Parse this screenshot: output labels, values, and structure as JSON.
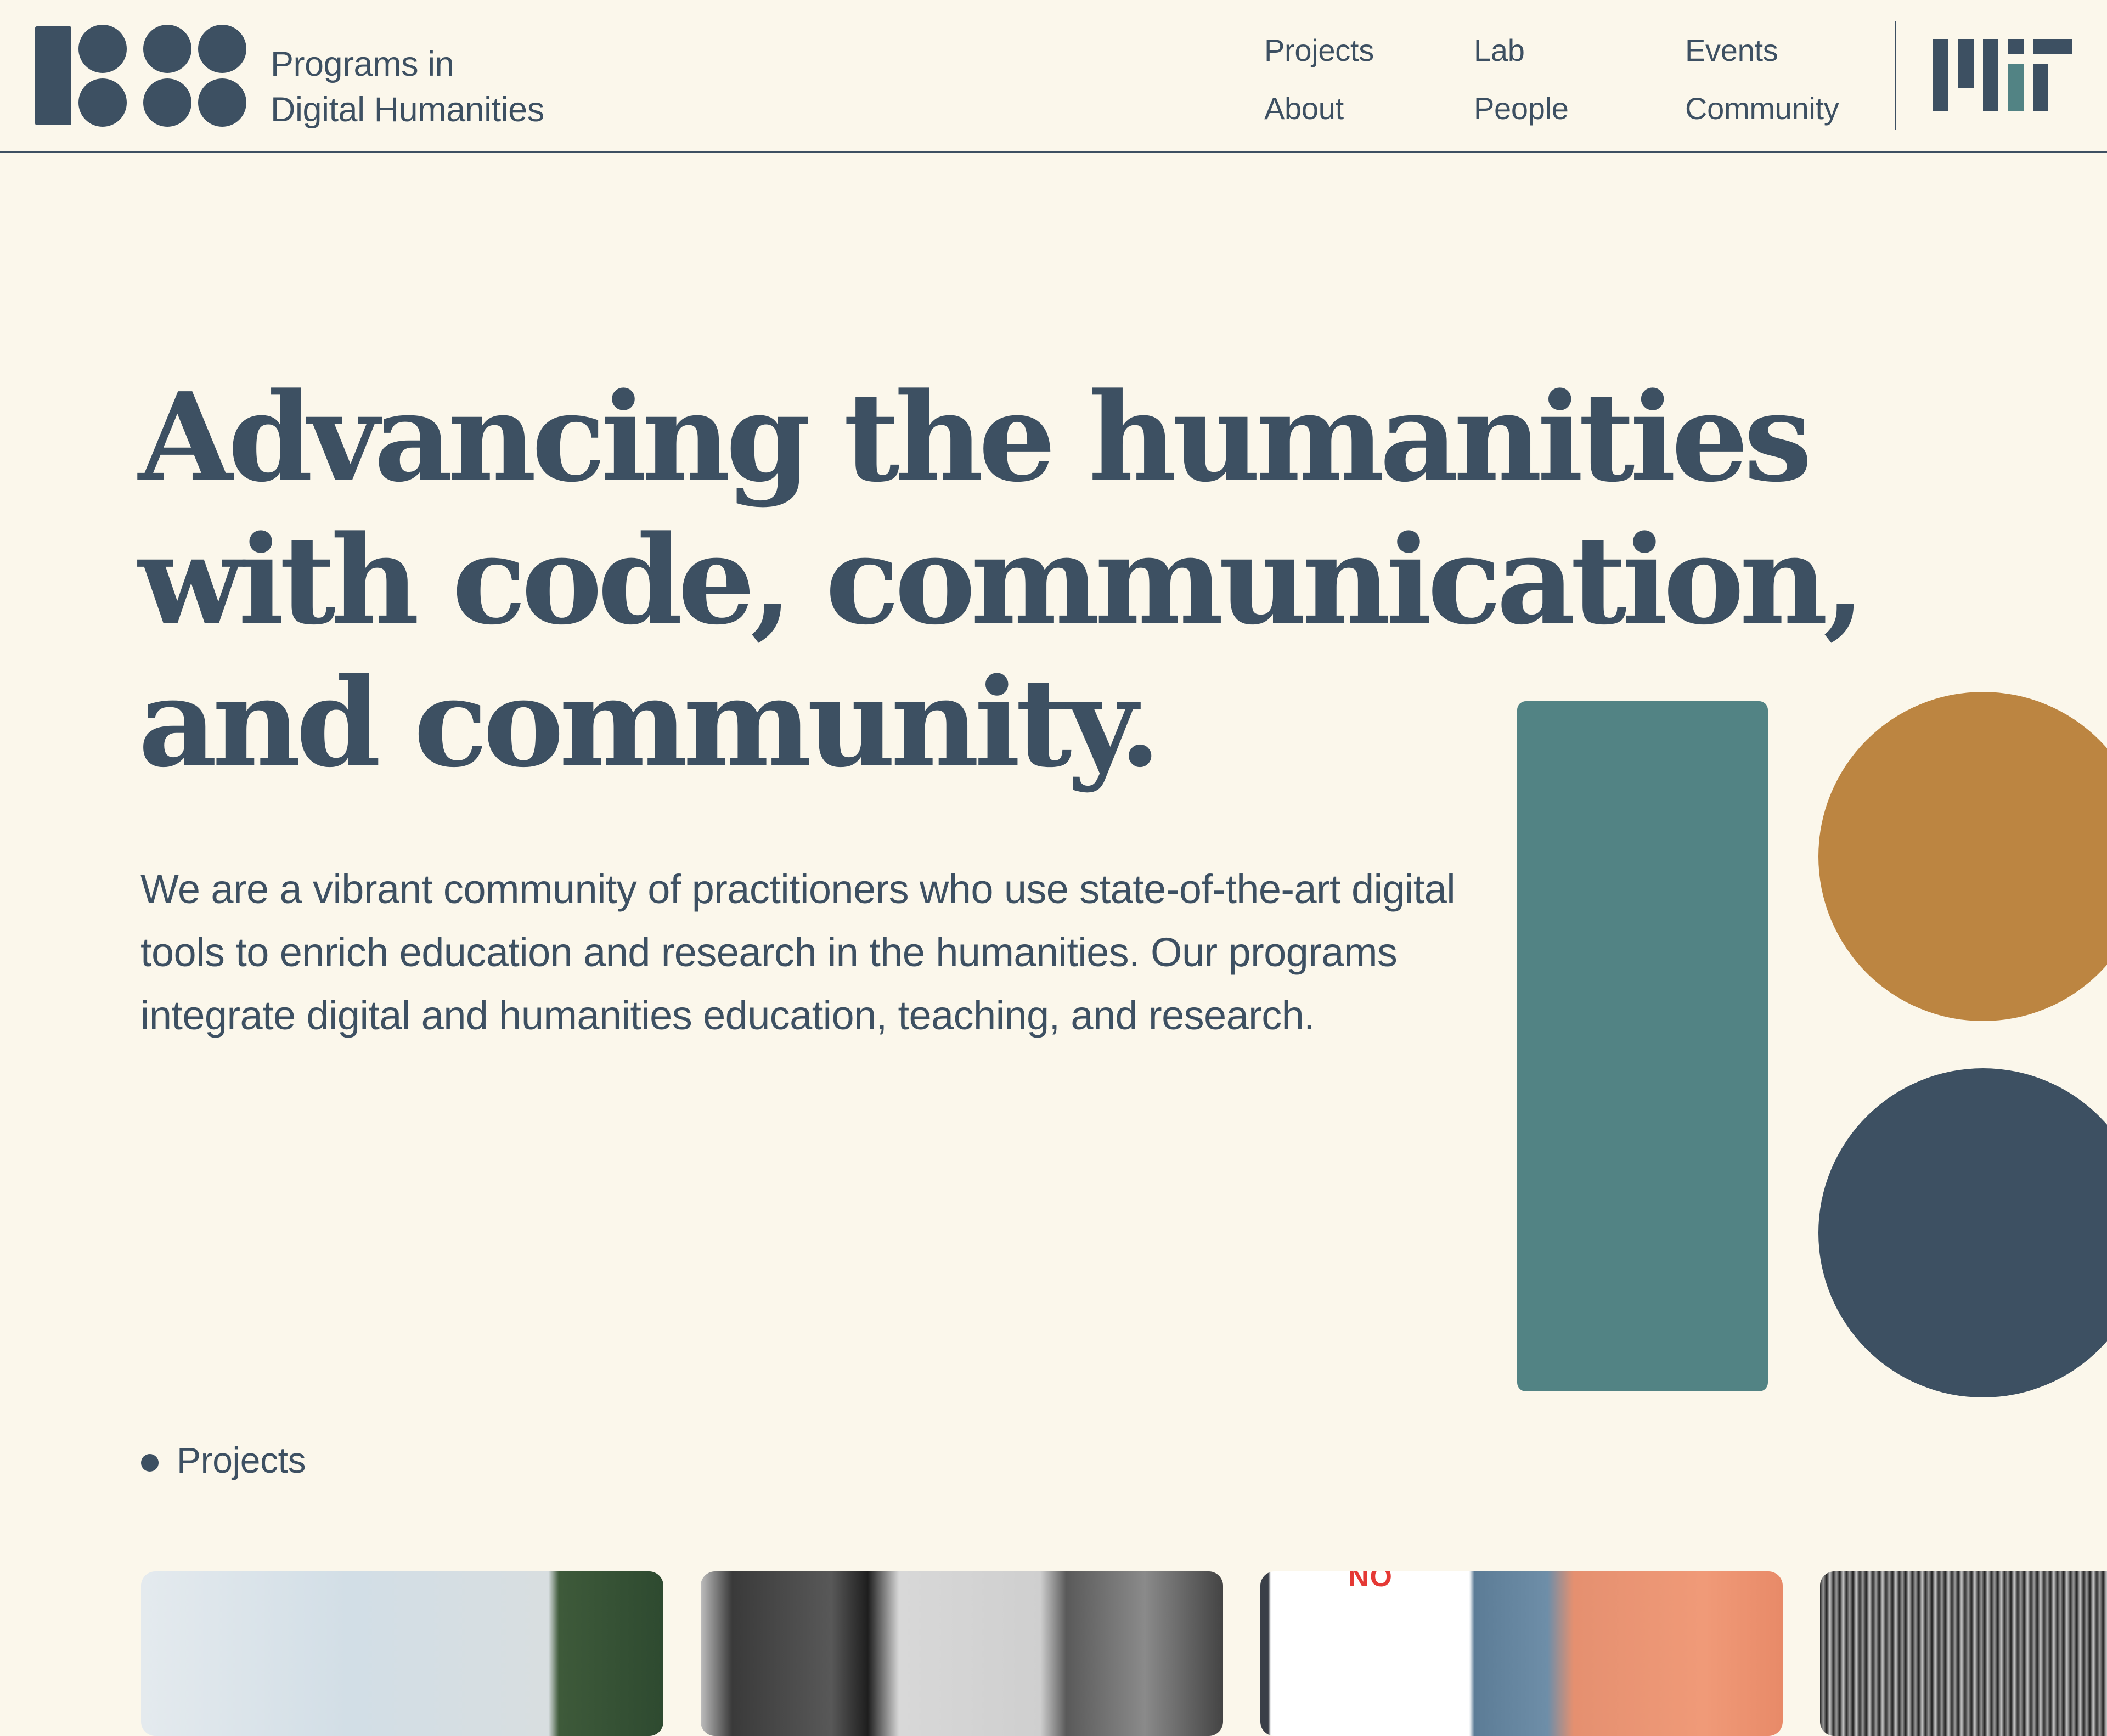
{
  "header": {
    "brand": {
      "line1": "Programs in",
      "line2": "Digital Humanities"
    },
    "nav": [
      {
        "label": "Projects"
      },
      {
        "label": "About"
      },
      {
        "label": "Lab"
      },
      {
        "label": "People"
      },
      {
        "label": "Events"
      },
      {
        "label": "Community"
      }
    ],
    "partner_logo": "MIT"
  },
  "hero": {
    "title_lines": [
      "Advancing the humanities",
      "with code, communication,",
      "and community."
    ],
    "description_lines": [
      "We are a vibrant community of practitioners who use state-of-the-art digital",
      "tools to enrich education and research in the humanities. Our programs",
      "integrate digital and humanities education, teaching, and research."
    ]
  },
  "projects": {
    "section_label": "Projects",
    "card_3_partial_text": "NO"
  },
  "colors": {
    "background": "#FBF7EB",
    "navy": "#3D5062",
    "teal": "#528384",
    "ochre": "#BC8541"
  }
}
